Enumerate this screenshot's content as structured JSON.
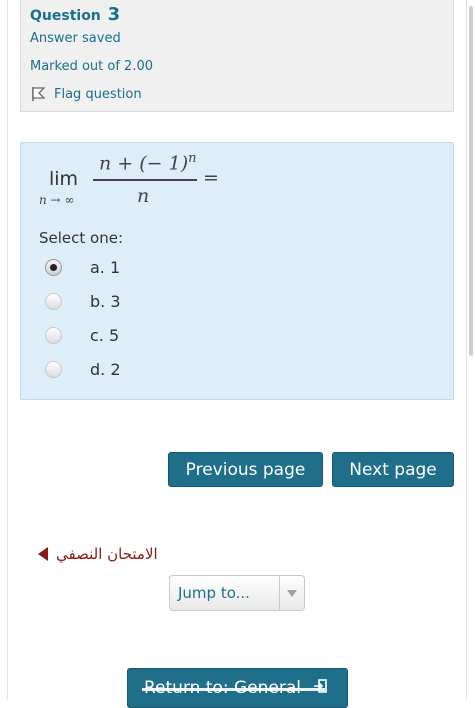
{
  "question": {
    "label": "Question",
    "number": "3",
    "state": "Answer saved",
    "grade": "Marked out of 2.00",
    "flag_label": "Flag question"
  },
  "formula": {
    "lim": "lim",
    "subscript": "n → ∞",
    "numerator_main": "n + (− 1)",
    "numerator_exp": "n",
    "denominator": "n",
    "equals": "="
  },
  "prompt": "Select one:",
  "options": [
    {
      "letter": "a.",
      "value": "1",
      "selected": true
    },
    {
      "letter": "b.",
      "value": "3",
      "selected": false
    },
    {
      "letter": "c.",
      "value": "5",
      "selected": false
    },
    {
      "letter": "d.",
      "value": "2",
      "selected": false
    }
  ],
  "buttons": {
    "previous": "Previous page",
    "next": "Next page",
    "return": "Return to: General"
  },
  "nav_link": "الامتحان النصفي",
  "jump": {
    "label": "Jump to..."
  },
  "colors": {
    "button_bg": "#1f6f8b",
    "link": "#1a6f8f",
    "question_bg": "#deeef9",
    "nav_link": "#8a1a16"
  }
}
